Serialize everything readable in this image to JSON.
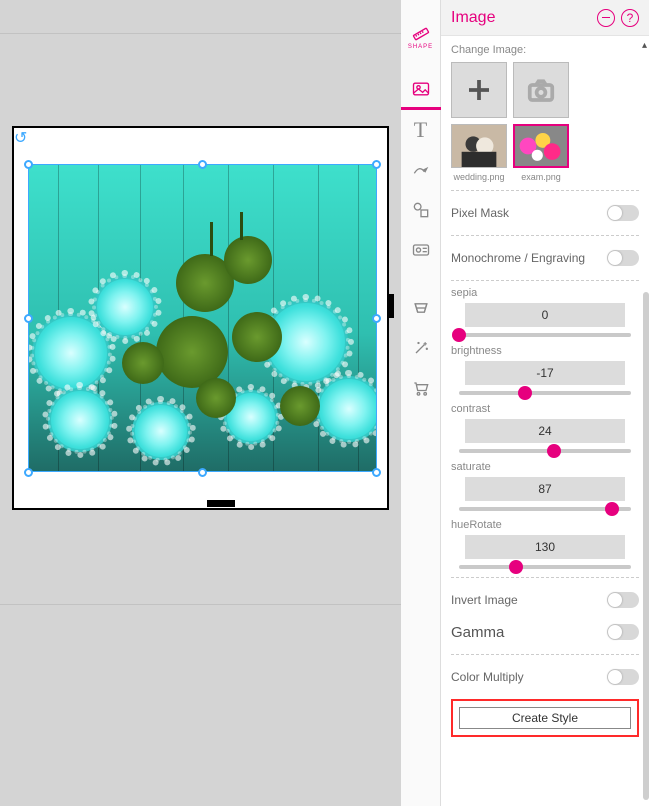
{
  "panel": {
    "title": "Image",
    "change_label": "Change Image:",
    "samples": [
      {
        "name": "wedding.png"
      },
      {
        "name": "exam.png"
      }
    ],
    "pixel_mask_label": "Pixel Mask",
    "monochrome_label": "Monochrome / Engraving",
    "invert_label": "Invert Image",
    "gamma_label": "Gamma",
    "color_multiply_label": "Color Multiply",
    "create_label": "Create Style"
  },
  "sliders": {
    "sepia": {
      "label": "sepia",
      "value": "0",
      "pos": 0
    },
    "brightness": {
      "label": "brightness",
      "value": "-17",
      "pos": 42
    },
    "contrast": {
      "label": "contrast",
      "value": "24",
      "pos": 60
    },
    "saturate": {
      "label": "saturate",
      "value": "87",
      "pos": 97
    },
    "hueRotate": {
      "label": "hueRotate",
      "value": "130",
      "pos": 36
    }
  },
  "toolbar": {
    "ruler_label": "SHAPE"
  }
}
